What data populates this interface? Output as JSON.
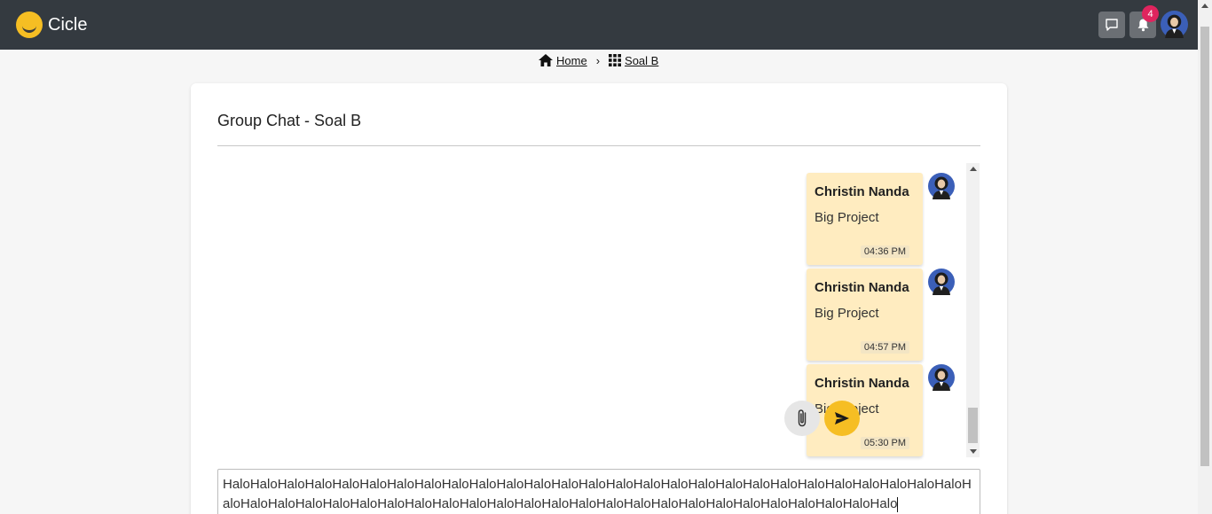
{
  "app": {
    "brand": "Cicle"
  },
  "header": {
    "notification_count": "4"
  },
  "breadcrumb": {
    "home": "Home",
    "separator": "›",
    "current": "Soal B"
  },
  "chat": {
    "title": "Group Chat - Soal B",
    "messages": [
      {
        "sender": "Christin Nanda",
        "text": "Big Project",
        "time": "04:36 PM"
      },
      {
        "sender": "Christin Nanda",
        "text": "Big Project",
        "time": "04:57 PM"
      },
      {
        "sender": "Christin Nanda",
        "text": "Big Project",
        "time": "05:30 PM"
      }
    ],
    "composer_value": "HaloHaloHaloHaloHaloHaloHaloHaloHaloHaloHaloHaloHaloHaloHaloHaloHaloHaloHaloHaloHaloHaloHaloHaloHaloHaloHaloHaloHaloHaloHaloHaloHaloHaloHaloHaloHaloHaloHaloHaloHaloHaloHaloHaloHaloHaloHaloHaloHaloHaloHaloHalo"
  },
  "icons": {
    "chat": "chat-bubble-icon",
    "bell": "bell-icon",
    "home": "home-icon",
    "grid": "grid-icon",
    "attach": "paperclip-icon",
    "send": "send-icon"
  },
  "colors": {
    "topbar": "#343a40",
    "accent": "#f6be23",
    "bubble": "#ffecc0",
    "badge": "#e0245e"
  }
}
